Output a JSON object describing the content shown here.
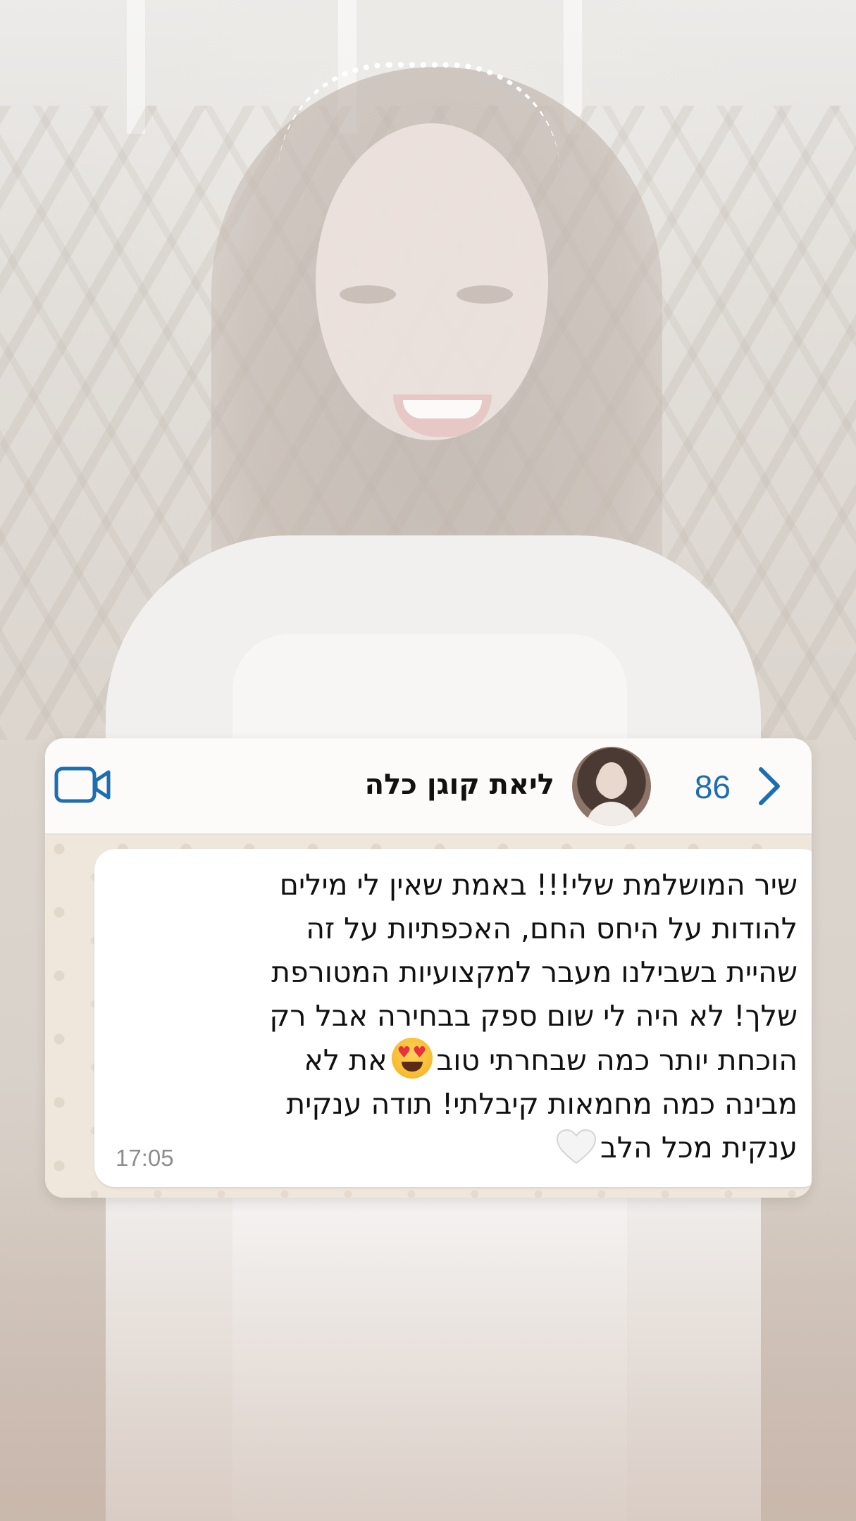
{
  "chat": {
    "header": {
      "back_count": "86",
      "contact_name": "ליאת קוגן כלה"
    },
    "message": {
      "lines": [
        "שיר המושלמת שלי!!! באמת שאין לי מילים",
        "להודות על היחס החם, האכפתיות על זה",
        "שהיית בשבילנו מעבר למקצועיות המטורפת",
        "שלך! לא היה לי שום ספק בבחירה אבל רק",
        "הוכחת יותר כמה שבחרתי טוב",
        "את לא",
        "מבינה כמה מחמאות קיבלתי! תודה ענקית",
        "ענקית מכל הלב"
      ],
      "time": "17:05"
    },
    "icons": {
      "video": "video-camera-icon",
      "back": "chevron-left-icon",
      "emoji_1": "smiling-face-with-heart-eyes-emoji",
      "emoji_2": "white-heart-emoji"
    },
    "colors": {
      "accent": "#1c6eb1",
      "bubble": "#ffffff",
      "chat_background": "#efe7dc",
      "header_background": "#fcfbf9"
    }
  }
}
